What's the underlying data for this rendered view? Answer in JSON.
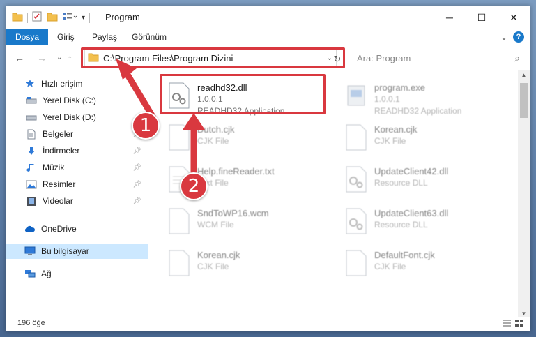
{
  "window": {
    "title": "Program",
    "minimize": "─",
    "maximize": "☐",
    "close": "✕"
  },
  "ribbon": {
    "tabs": [
      "Dosya",
      "Giriş",
      "Paylaş",
      "Görünüm"
    ],
    "expand": "⌄",
    "help": "?"
  },
  "nav": {
    "back": "←",
    "forward": "→",
    "recent": "⌄",
    "up": "↑",
    "address": "C:\\Program Files\\Program Dizini",
    "address_dropdown": "⌄",
    "refresh": "↻",
    "search_placeholder": "Ara: Program",
    "search_icon": "⌕"
  },
  "sidebar": {
    "items": [
      {
        "label": "Hızlı erişim",
        "icon": "star-icon",
        "pinned": false
      },
      {
        "label": "Yerel Disk (C:)",
        "icon": "drive-c-icon",
        "pinned": false
      },
      {
        "label": "Yerel Disk (D:)",
        "icon": "drive-d-icon",
        "pinned": false
      },
      {
        "label": "Belgeler",
        "icon": "documents-icon",
        "pinned": true
      },
      {
        "label": "İndirmeler",
        "icon": "downloads-icon",
        "pinned": true
      },
      {
        "label": "Müzik",
        "icon": "music-icon",
        "pinned": true
      },
      {
        "label": "Resimler",
        "icon": "pictures-icon",
        "pinned": true
      },
      {
        "label": "Videolar",
        "icon": "videos-icon",
        "pinned": true
      },
      {
        "label": "OneDrive",
        "icon": "onedrive-icon",
        "pinned": false
      },
      {
        "label": "Bu bilgisayar",
        "icon": "this-pc-icon",
        "pinned": false
      },
      {
        "label": "Ağ",
        "icon": "network-icon",
        "pinned": false
      }
    ]
  },
  "files": [
    {
      "name": "readhd32.dll",
      "line2": "1.0.0.1",
      "line3": "READHD32 Application"
    },
    {
      "name": "program.exe",
      "line2": "1.0.0.1",
      "line3": "READHD32 Application"
    },
    {
      "name": "Dutch.cjk",
      "line2": "CJK File",
      "line3": ""
    },
    {
      "name": "Korean.cjk",
      "line2": "CJK File",
      "line3": ""
    },
    {
      "name": "Help.fineReader.txt",
      "line2": "Text File",
      "line3": ""
    },
    {
      "name": "UpdateClient42.dll",
      "line2": "Resource DLL",
      "line3": ""
    },
    {
      "name": "SndToWP16.wcm",
      "line2": "WCM File",
      "line3": ""
    },
    {
      "name": "UpdateClient63.dll",
      "line2": "Resource DLL",
      "line3": ""
    },
    {
      "name": "Korean.cjk",
      "line2": "CJK File",
      "line3": ""
    },
    {
      "name": "DefaultFont.cjk",
      "line2": "CJK File",
      "line3": ""
    }
  ],
  "status": {
    "count": "196 öğe"
  },
  "callouts": [
    "1",
    "2"
  ],
  "colors": {
    "accent": "#1979ca",
    "highlight": "#d9383f",
    "selection": "#cce8ff"
  }
}
